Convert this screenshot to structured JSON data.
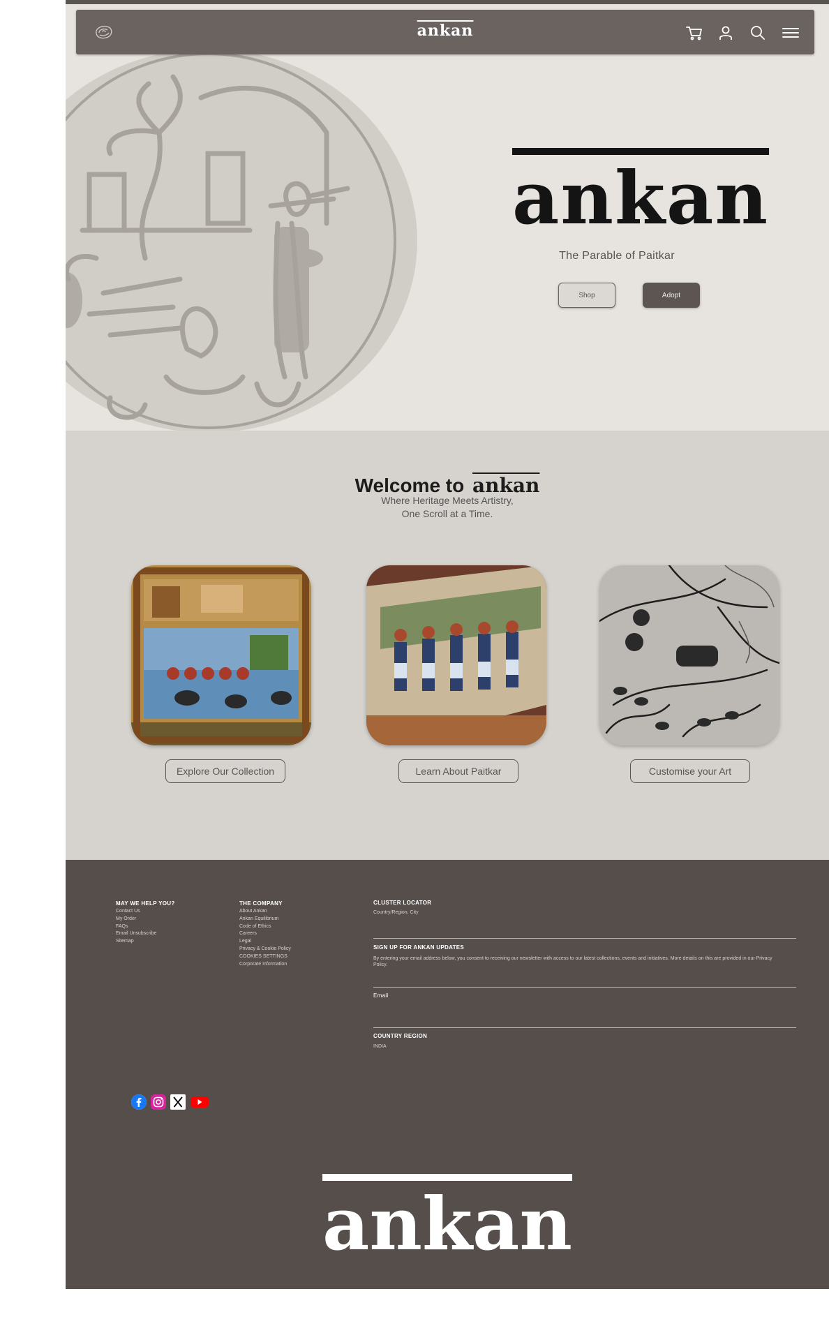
{
  "brand": {
    "name": "ankan",
    "tagline": "The Parable of Paitkar"
  },
  "nav": {
    "icons": [
      "paisley-logo-icon",
      "cart-icon",
      "user-icon",
      "search-icon",
      "menu-icon"
    ]
  },
  "hero": {
    "buttons": {
      "shop": "Shop",
      "adopt": "Adopt"
    }
  },
  "welcome": {
    "title_prefix": "Welcome to",
    "subtitle_line1": "Where Heritage Meets Artistry,",
    "subtitle_line2": "One Scroll at a Time.",
    "cards": [
      {
        "button": "Explore Our Collection"
      },
      {
        "button": "Learn About Paitkar"
      },
      {
        "button": "Customise your Art"
      }
    ]
  },
  "footer": {
    "help": {
      "heading": "MAY WE HELP YOU?",
      "links": [
        "Contact Us",
        "My Order",
        "FAQs",
        "Email Unsubscribe",
        "Sitemap"
      ]
    },
    "company": {
      "heading": "THE COMPANY",
      "links": [
        "About Ankan",
        "Ankan Equilibrium",
        "Code of Ethics",
        "Careers",
        "Legal",
        "Privacy & Cookie Policy",
        "COOKIES SETTINGS",
        "Corporate Information"
      ]
    },
    "cluster": {
      "heading": "CLUSTER LOCATOR",
      "value": "Country/Region, City"
    },
    "signup": {
      "heading": "SIGN UP FOR ANKAN UPDATES",
      "text": "By entering your email address below, you consent to receiving our newsletter with access to our latest collections, events and initiatives. More details on this are provided in our Privacy Policy.",
      "email_label": "Email"
    },
    "country": {
      "heading": "COUNTRY REGION",
      "value": "INDIA"
    },
    "social": [
      "facebook-icon",
      "instagram-icon",
      "x-icon",
      "youtube-icon"
    ]
  },
  "colors": {
    "navbar": "#6a6360",
    "hero_bg": "#e7e3de",
    "welcome_bg": "#d6d3ce",
    "footer_bg": "#554e4b",
    "button_dark": "#5c5552"
  }
}
